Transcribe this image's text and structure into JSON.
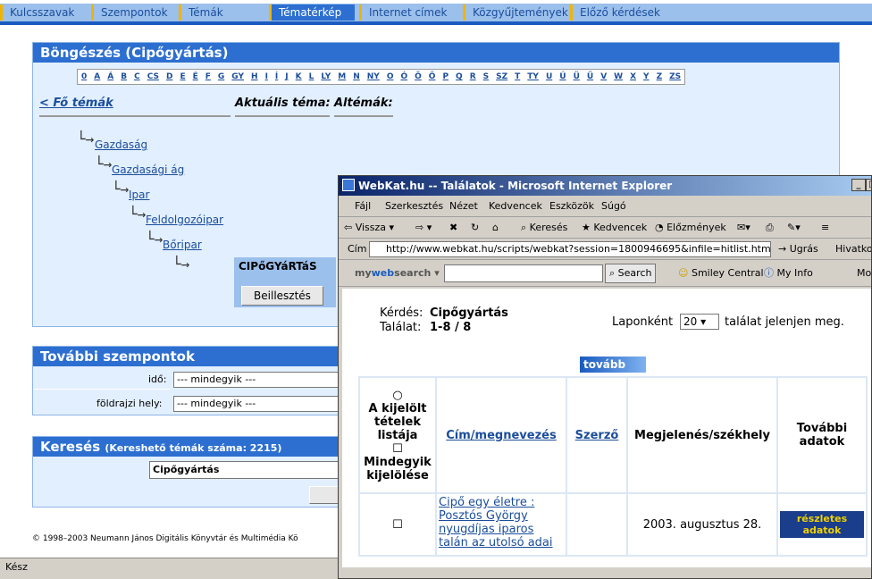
{
  "nav": {
    "tabs": [
      "Kulcsszavak",
      "Szempontok",
      "Témák",
      "Tématérkép",
      "Internet címek",
      "Közgyűjtemények",
      "Előző kérdések"
    ],
    "active": "Tématérkép"
  },
  "browse": {
    "title": "Böngészés (Cipőgyártás)",
    "letters": [
      "0",
      "A",
      "Á",
      "B",
      "C",
      "CS",
      "D",
      "E",
      "É",
      "F",
      "G",
      "GY",
      "H",
      "I",
      "Í",
      "J",
      "K",
      "L",
      "LY",
      "M",
      "N",
      "NY",
      "O",
      "Ó",
      "Ö",
      "Ő",
      "P",
      "Q",
      "R",
      "S",
      "SZ",
      "T",
      "TY",
      "U",
      "Ú",
      "Ü",
      "Ű",
      "V",
      "W",
      "X",
      "Y",
      "Z",
      "ZS"
    ],
    "main_topics_link": "< Fő témák",
    "current_topic_label": "Aktuális téma:",
    "subtopics_label": "Altémák:",
    "tree": [
      "Gazdaság",
      "Gazdasági ág",
      "Ipar",
      "Feldolgozóipar",
      "Bőripar"
    ],
    "current_topic": "CIPőGYáRTáS",
    "insert_button": "Beillesztés"
  },
  "aspects": {
    "title": "További szempontok",
    "time_label": "idő:",
    "time_value": "--- mindegyik ---",
    "geo_label": "földrajzi hely:",
    "geo_value": "--- mindegyik ---"
  },
  "search": {
    "title": "Keresés",
    "subtitle": "(Kereshető témák száma: 2215)",
    "value": "Cipőgyártás"
  },
  "footer": {
    "copyright": "© 1998–2003 Neumann János Digitális Könyvtár és Multimédia Kö"
  },
  "status": {
    "text": "Kész"
  },
  "ie": {
    "title": "WebKat.hu -- Találatok - Microsoft Internet Explorer",
    "menu": [
      "Fájl",
      "Szerkesztés",
      "Nézet",
      "Kedvencek",
      "Eszközök",
      "Súgó"
    ],
    "toolbar": {
      "back": "Vissza",
      "search": "Keresés",
      "favorites": "Kedvencek",
      "history": "Előzmények"
    },
    "address_label": "Cím",
    "address": "http://www.webkat.hu/scripts/webkat?session=1800946695&infile=hitlist.html",
    "go": "Ugrás",
    "links": "Hivatkoz",
    "websearch": {
      "brand_my": "my",
      "brand_web": "web",
      "brand_search": "search",
      "search_btn": "Search",
      "smiley": "Smiley Central",
      "myinfo": "My Info",
      "more": "Mo"
    },
    "page": {
      "query_label": "Kérdés:",
      "query_value": "Cipőgyártás",
      "hits_label": "Találat:",
      "hits_value": "1-8 / 8",
      "per_page_prefix": "Laponként",
      "per_page_value": "20",
      "per_page_suffix": "találat jelenjen meg.",
      "next_button": "tovább",
      "col_select": "A kijelölt tételek listája",
      "col_select_all": "Mindegyik kijelölése",
      "col_title": "Cím/megnevezés",
      "col_author": "Szerző",
      "col_pub": "Megjelenés/székhely",
      "col_more": "További adatok",
      "row1_title": "Cipő egy életre : Posztós György nyugdíjas iparos talán az utolsó adai",
      "row1_pub": "2003. augusztus 28.",
      "row1_more": "részletes adatok"
    }
  }
}
